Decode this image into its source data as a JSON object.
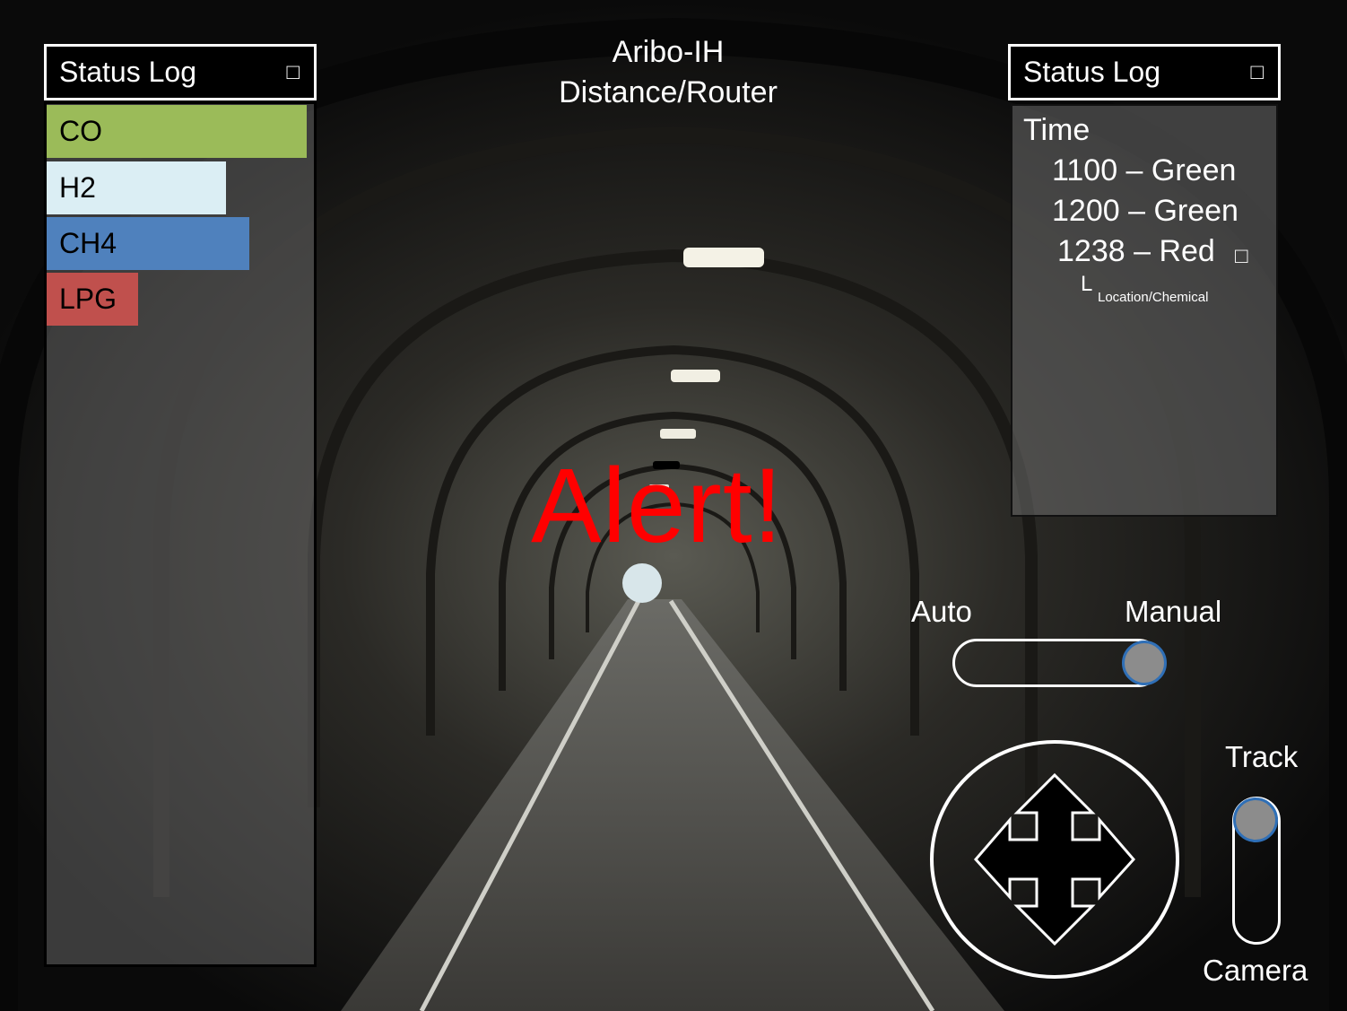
{
  "title": {
    "line1": "Aribo-IH",
    "line2": "Distance/Router"
  },
  "alert_text": "Alert!",
  "left_panel": {
    "header": "Status Log",
    "checkbox_glyph": "□",
    "gases": [
      {
        "label": "CO",
        "color": "#9bbb59",
        "level": 1.0
      },
      {
        "label": "H2",
        "color": "#dbeef4",
        "level": 0.69
      },
      {
        "label": "CH4",
        "color": "#4f81bd",
        "level": 0.78
      },
      {
        "label": "LPG",
        "color": "#c0504d",
        "level": 0.35
      }
    ]
  },
  "right_panel": {
    "header": "Status Log",
    "checkbox_glyph": "□",
    "time_label": "Time",
    "entries": [
      {
        "text": "1100 – Green"
      },
      {
        "text": "1200 – Green"
      },
      {
        "text": "1238 – Red",
        "checkbox_glyph": "□"
      }
    ],
    "sub_glyph": "L",
    "sub_label": "Location/Chemical"
  },
  "mode_toggle": {
    "left_label": "Auto",
    "right_label": "Manual",
    "selected": "Manual"
  },
  "view_toggle": {
    "top_label": "Track",
    "bottom_label": "Camera",
    "selected": "Track"
  },
  "direction_pad": {
    "icon": "four-way-arrow-icon"
  }
}
